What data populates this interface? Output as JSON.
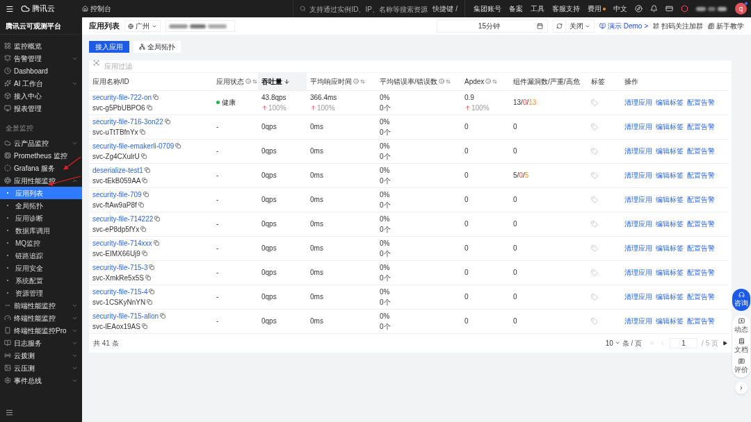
{
  "topbar": {
    "brand": "腾讯云",
    "console": "控制台",
    "search_placeholder": "支持通过实例ID、IP、名称等搜索资源",
    "shortcut": "快捷键 /",
    "links": [
      {
        "label": "集团账号",
        "dot": false
      },
      {
        "label": "备案",
        "dot": false
      },
      {
        "label": "工具",
        "dot": false
      },
      {
        "label": "客服支持",
        "dot": false
      },
      {
        "label": "费用",
        "dot": true
      }
    ],
    "language": "中文",
    "avatar": "q",
    "avatar_notification": true
  },
  "sidebar": {
    "title": "腾讯云可观测平台",
    "items": [
      {
        "kind": "item",
        "label": "监控概览",
        "selected": false
      },
      {
        "kind": "item",
        "label": "告警管理",
        "selected": false,
        "expanded": false
      },
      {
        "kind": "item",
        "label": "Dashboard",
        "selected": false
      },
      {
        "kind": "item",
        "label": "AI 工作台",
        "selected": false,
        "expanded": false
      },
      {
        "kind": "item",
        "label": "接入中心",
        "selected": false
      },
      {
        "kind": "item",
        "label": "报表管理",
        "selected": false
      },
      {
        "kind": "section",
        "label": "全景监控"
      },
      {
        "kind": "item",
        "label": "云产品监控",
        "selected": false,
        "expanded": false
      },
      {
        "kind": "item",
        "label": "Prometheus 监控",
        "selected": false
      },
      {
        "kind": "item",
        "label": "Grafana 服务",
        "selected": false
      },
      {
        "kind": "item",
        "label": "应用性能监控",
        "selected": false,
        "expanded": true,
        "children": [
          {
            "label": "应用列表",
            "selected": true
          },
          {
            "label": "全局拓扑",
            "selected": false
          },
          {
            "label": "应用诊断",
            "selected": false
          },
          {
            "label": "数据库调用",
            "selected": false
          },
          {
            "label": "MQ监控",
            "selected": false
          },
          {
            "label": "链路追踪",
            "selected": false
          },
          {
            "label": "应用安全",
            "selected": false
          },
          {
            "label": "系统配置",
            "selected": false
          },
          {
            "label": "资源管理",
            "selected": false
          }
        ]
      },
      {
        "kind": "item",
        "label": "前端性能监控",
        "selected": false,
        "expanded": false
      },
      {
        "kind": "item",
        "label": "终端性能监控",
        "selected": false,
        "expanded": false
      },
      {
        "kind": "item",
        "label": "终端性能监控Pro",
        "selected": false,
        "expanded": false
      },
      {
        "kind": "item",
        "label": "日志服务",
        "selected": false,
        "expanded": false
      },
      {
        "kind": "item",
        "label": "云拨测",
        "selected": false,
        "expanded": false
      },
      {
        "kind": "item",
        "label": "云压测",
        "selected": false,
        "expanded": false
      },
      {
        "kind": "item",
        "label": "事件总线",
        "selected": false,
        "expanded": false
      }
    ]
  },
  "header": {
    "title": "应用列表",
    "region": "广州",
    "time_range": "15分钟",
    "auto_refresh": "关闭",
    "demo_link": "演示 Demo >",
    "qr_link": "扫码关注加群",
    "tutorial_link": "新手教学"
  },
  "toolbar": {
    "primary_button": "接入应用",
    "topology_button": "全局拓扑",
    "filter_placeholder": "应用过滤"
  },
  "table": {
    "columns": [
      {
        "label": "应用名称/ID",
        "info": false,
        "sortable": false,
        "sorted": false
      },
      {
        "label": "应用状态",
        "info": true,
        "sortable": true,
        "sorted": false
      },
      {
        "label": "吞吐量",
        "info": false,
        "sortable": true,
        "sorted": true
      },
      {
        "label": "平均响应时间",
        "info": true,
        "sortable": true,
        "sorted": false
      },
      {
        "label": "平均错误率/错误数",
        "info": true,
        "sortable": true,
        "sorted": false
      },
      {
        "label": "Apdex",
        "info": true,
        "sortable": true,
        "sorted": false
      },
      {
        "label": "组件漏洞数/严重/高危",
        "info": false,
        "sortable": false,
        "sorted": false
      },
      {
        "label": "标签",
        "info": false,
        "sortable": false,
        "sorted": false
      },
      {
        "label": "操作",
        "info": false,
        "sortable": false,
        "sorted": false
      }
    ],
    "rows": [
      {
        "name": "security-file-722-on",
        "id": "svc-g5PbUBPO6",
        "status": {
          "text": "健康",
          "color": "#22b34a"
        },
        "throughput": "43.8qps",
        "throughput_change": {
          "text": "100%",
          "rising": true
        },
        "response": "366.4ms",
        "response_change": {
          "text": "100%",
          "rising": true
        },
        "error_rate": "0%",
        "error_count": "0个",
        "apdex": "0.9",
        "apdex_change": {
          "text": "100%",
          "rising": true
        },
        "vulns": [
          {
            "text": "13/",
            "kind": "total"
          },
          {
            "text": "0",
            "kind": "severe"
          },
          {
            "text": "/",
            "kind": "total"
          },
          {
            "text": "13",
            "kind": "high"
          }
        ],
        "actions": [
          "清理应用",
          "编辑标签",
          "配置告警"
        ]
      },
      {
        "name": "security-file-716-3on22",
        "id": "svc-uTtTBfnYx",
        "status": {
          "text": "-"
        },
        "throughput": "0qps",
        "response": "0ms",
        "error_rate": "0%",
        "error_count": "0个",
        "apdex": "0",
        "vulns": [
          {
            "text": "0",
            "kind": "total"
          }
        ],
        "actions": [
          "清理应用",
          "编辑标签",
          "配置告警"
        ]
      },
      {
        "name": "security-file-emakerli-0709",
        "id": "svc-Zg4CXulrU",
        "status": {
          "text": "-"
        },
        "throughput": "0qps",
        "response": "0ms",
        "error_rate": "0%",
        "error_count": "0个",
        "apdex": "0",
        "vulns": [
          {
            "text": "0",
            "kind": "total"
          }
        ],
        "actions": [
          "清理应用",
          "编辑标签",
          "配置告警"
        ]
      },
      {
        "name": "deserialize-test1",
        "id": "svc-tEkB059AA",
        "status": {
          "text": "-"
        },
        "throughput": "0qps",
        "response": "0ms",
        "error_rate": "0%",
        "error_count": "0个",
        "apdex": "0",
        "vulns": [
          {
            "text": "5/",
            "kind": "total"
          },
          {
            "text": "0",
            "kind": "severe"
          },
          {
            "text": "/",
            "kind": "total"
          },
          {
            "text": "5",
            "kind": "high"
          }
        ],
        "actions": [
          "清理应用",
          "编辑标签",
          "配置告警"
        ]
      },
      {
        "name": "security-file-709",
        "id": "svc-ftAw9aP8f",
        "status": {
          "text": "-"
        },
        "throughput": "0qps",
        "response": "0ms",
        "error_rate": "0%",
        "error_count": "0个",
        "apdex": "0",
        "vulns": [
          {
            "text": "0",
            "kind": "total"
          }
        ],
        "actions": [
          "清理应用",
          "编辑标签",
          "配置告警"
        ]
      },
      {
        "name": "security-file-714222",
        "id": "svc-eP8dp5fYx",
        "status": {
          "text": "-"
        },
        "throughput": "0qps",
        "response": "0ms",
        "error_rate": "0%",
        "error_count": "0个",
        "apdex": "0",
        "vulns": [
          {
            "text": "0",
            "kind": "total"
          }
        ],
        "actions": [
          "清理应用",
          "编辑标签",
          "配置告警"
        ]
      },
      {
        "name": "security-file-714xxx",
        "id": "svc-EIMX66Uj9",
        "status": {
          "text": "-"
        },
        "throughput": "0qps",
        "response": "0ms",
        "error_rate": "0%",
        "error_count": "0个",
        "apdex": "0",
        "vulns": [
          {
            "text": "0",
            "kind": "total"
          }
        ],
        "actions": [
          "清理应用",
          "编辑标签",
          "配置告警"
        ]
      },
      {
        "name": "security-file-715-3",
        "id": "svc-XmkRe5x5S",
        "status": {
          "text": "-"
        },
        "throughput": "0qps",
        "response": "0ms",
        "error_rate": "0%",
        "error_count": "0个",
        "apdex": "0",
        "vulns": [
          {
            "text": "0",
            "kind": "total"
          }
        ],
        "actions": [
          "清理应用",
          "编辑标签",
          "配置告警"
        ]
      },
      {
        "name": "security-file-715-4",
        "id": "svc-1CSKyNnYN",
        "status": {
          "text": "-"
        },
        "throughput": "0qps",
        "response": "0ms",
        "error_rate": "0%",
        "error_count": "0个",
        "apdex": "0",
        "vulns": [
          {
            "text": "0",
            "kind": "total"
          }
        ],
        "actions": [
          "清理应用",
          "编辑标签",
          "配置告警"
        ]
      },
      {
        "name": "security-file-715-allon",
        "id": "svc-lEAox19AS",
        "status": {
          "text": "-"
        },
        "throughput": "0qps",
        "response": "0ms",
        "error_rate": "0%",
        "error_count": "0个",
        "apdex": "0",
        "vulns": [
          {
            "text": "0",
            "kind": "total"
          }
        ],
        "actions": [
          "清理应用",
          "编辑标签",
          "配置告警"
        ]
      }
    ]
  },
  "pagination": {
    "total": "共 41 条",
    "page_size": "10",
    "per_page_label": "条 / 页",
    "page": "1",
    "page_count": "/ 5 页"
  },
  "float_panel": {
    "consult": "咨询",
    "items": [
      "动态",
      "文档",
      "评价"
    ]
  }
}
